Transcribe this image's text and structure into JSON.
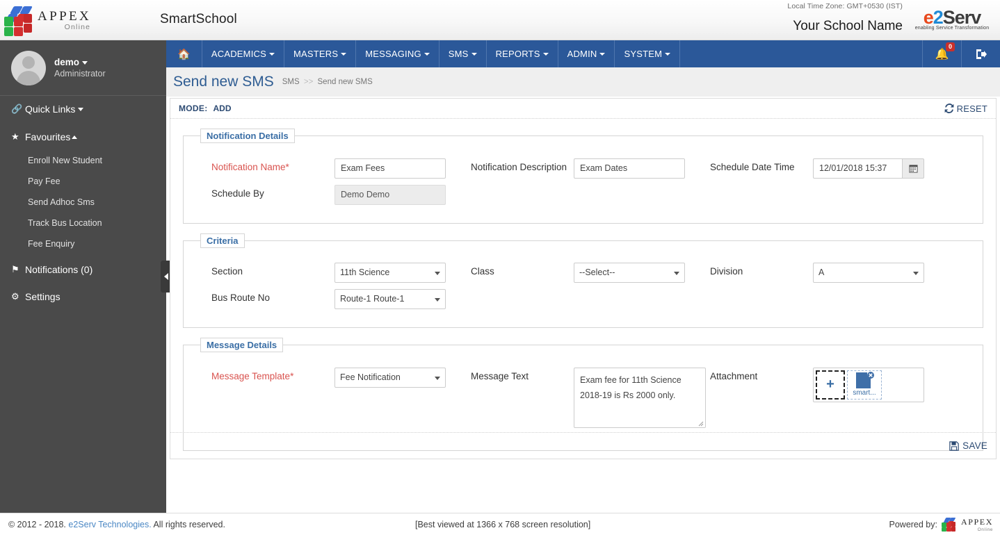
{
  "header": {
    "logo_text": "APPEX",
    "logo_sub": "Online",
    "app_title": "SmartSchool",
    "timezone": "Local Time Zone: GMT+0530 (IST)",
    "school_name": "Your School Name",
    "vendor_logo_e": "e",
    "vendor_logo_2": "2",
    "vendor_logo_serv": "Serv",
    "vendor_tagline": "enabling Service Transformation"
  },
  "sidebar": {
    "user_name": "demo",
    "user_role": "Administrator",
    "quick_links": "Quick Links",
    "favourites": "Favourites",
    "favourite_items": [
      {
        "label": "Enroll New Student"
      },
      {
        "label": "Pay Fee"
      },
      {
        "label": "Send Adhoc Sms"
      },
      {
        "label": "Track Bus Location"
      },
      {
        "label": "Fee Enquiry"
      }
    ],
    "notifications": "Notifications (0)",
    "settings": "Settings"
  },
  "mainnav": {
    "home_icon": "home-icon",
    "items": [
      {
        "label": "ACADEMICS"
      },
      {
        "label": "MASTERS"
      },
      {
        "label": "MESSAGING"
      },
      {
        "label": "SMS"
      },
      {
        "label": "REPORTS"
      },
      {
        "label": "ADMIN"
      },
      {
        "label": "SYSTEM"
      }
    ],
    "notification_count": "0"
  },
  "page": {
    "title": "Send new SMS",
    "breadcrumb_root": "SMS",
    "breadcrumb_sep": ">>",
    "breadcrumb_current": "Send new SMS",
    "mode_label": "MODE:",
    "mode_value": "ADD",
    "reset_label": "RESET",
    "save_label": "SAVE"
  },
  "notification_details": {
    "legend": "Notification Details",
    "notification_name_label": "Notification Name*",
    "notification_name_value": "Exam Fees",
    "notification_description_label": "Notification Description",
    "notification_description_value": "Exam Dates",
    "schedule_date_time_label": "Schedule Date Time",
    "schedule_date_time_value": "12/01/2018 15:37",
    "schedule_by_label": "Schedule By",
    "schedule_by_value": "Demo Demo"
  },
  "criteria": {
    "legend": "Criteria",
    "section_label": "Section",
    "section_value": "11th Science",
    "class_label": "Class",
    "class_value": "--Select--",
    "division_label": "Division",
    "division_value": "A",
    "bus_route_label": "Bus Route No",
    "bus_route_value": "Route-1 Route-1"
  },
  "message_details": {
    "legend": "Message Details",
    "message_template_label": "Message Template*",
    "message_template_value": "Fee Notification",
    "message_text_label": "Message Text",
    "message_text_value": "Exam fee for 11th Science 2018-19 is Rs 2000 only.",
    "attachment_label": "Attachment",
    "attachment_add": "+",
    "attachment_file_name": "smart..."
  },
  "footer": {
    "copyright_pre": "© 2012 - 2018.",
    "copyright_link": "e2Serv Technologies.",
    "copyright_post": "All rights reserved.",
    "best_viewed": "[Best viewed at 1366 x 768 screen resolution]",
    "powered_by": "Powered by:",
    "powered_logo": "APPEX",
    "powered_logo_sub": "Online"
  },
  "colors": {
    "nav_blue": "#2b5899",
    "sidebar_gray": "#4a4a4a",
    "accent_link": "#3a6ea5",
    "required_red": "#d9534f",
    "badge_red": "#c9302c"
  }
}
